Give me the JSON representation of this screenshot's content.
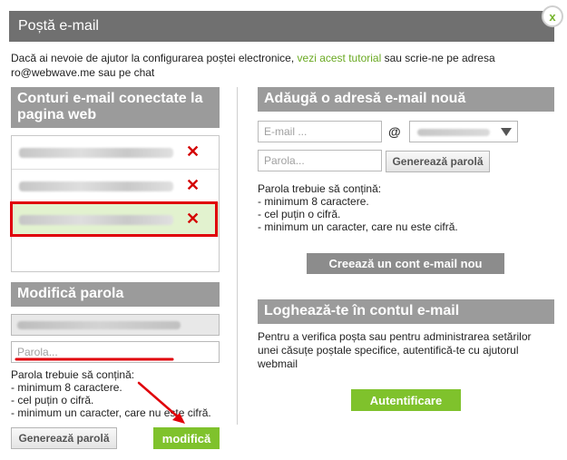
{
  "dialog": {
    "title": "Poștă e-mail",
    "close_label": "x"
  },
  "intro": {
    "text_before": "Dacă ai nevoie de ajutor la configurarea poștei electronice, ",
    "link": "vezi acest tutorial",
    "text_after": " sau scrie-ne pe adresa ro@webwave.me sau pe chat"
  },
  "accounts": {
    "heading": "Conturi e-mail conectate la pagina web",
    "delete_icon": "✕"
  },
  "change_password": {
    "heading": "Modifică parola",
    "password_placeholder": "Parola...",
    "rules_title": "Parola trebuie să conțină:",
    "rules": [
      "- minimum 8 caractere.",
      "- cel puțin o cifră.",
      "- minimum un caracter, care nu este cifră."
    ],
    "generate_label": "Generează parolă",
    "modify_label": "modifică"
  },
  "add_address": {
    "heading": "Adăugă o adresă e-mail nouă",
    "email_placeholder": "E-mail ...",
    "at_sign": "@",
    "password_placeholder": "Parola...",
    "generate_label": "Generează parolă",
    "rules_title": "Parola trebuie să conțină:",
    "rules": [
      "- minimum 8 caractere.",
      "- cel puțin o cifră.",
      "- minimum un caracter, care nu este cifră."
    ],
    "create_label": "Creează un cont e-mail nou"
  },
  "login": {
    "heading": "Loghează-te în contul e-mail",
    "text": "Pentru a verifica poșta sau pentru administrarea setărilor unei căsuțe poștale specifice, autentifică-te cu ajutorul webmail",
    "button_label": "Autentificare"
  },
  "colors": {
    "accent_green": "#7fc22c",
    "link_green": "#6aa922",
    "header_gray": "#707070",
    "annotation_red": "#e0000a"
  }
}
